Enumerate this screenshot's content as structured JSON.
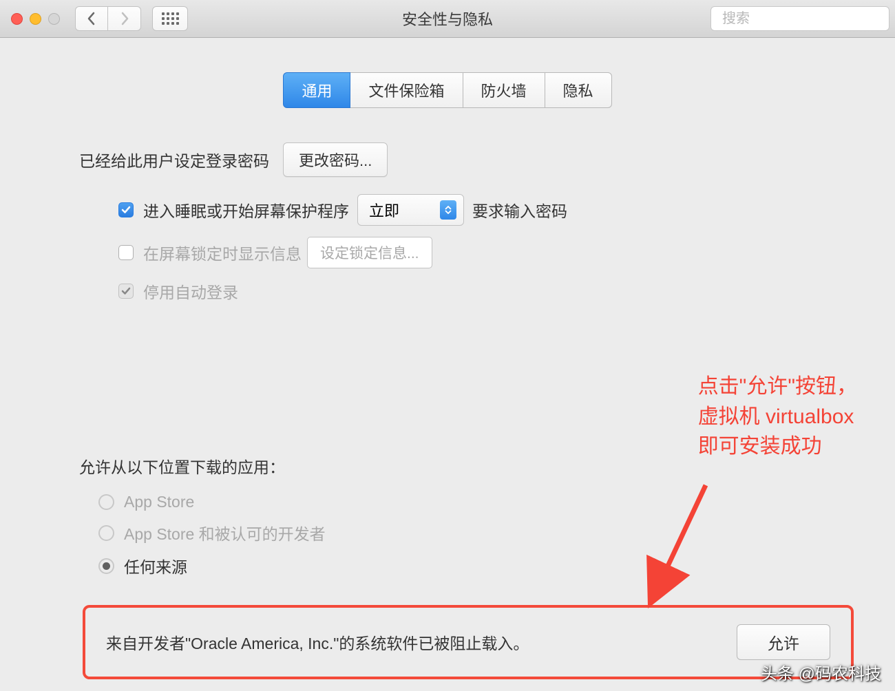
{
  "window": {
    "title": "安全性与隐私"
  },
  "search": {
    "placeholder": "搜索"
  },
  "tabs": [
    {
      "label": "通用",
      "active": true
    },
    {
      "label": "文件保险箱",
      "active": false
    },
    {
      "label": "防火墙",
      "active": false
    },
    {
      "label": "隐私",
      "active": false
    }
  ],
  "password_section": {
    "set_label": "已经给此用户设定登录密码",
    "change_button": "更改密码...",
    "require_password_prefix": "进入睡眠或开始屏幕保护程序",
    "require_password_delay": "立即",
    "require_password_suffix": "要求输入密码",
    "show_message_label": "在屏幕锁定时显示信息",
    "set_lock_message_button": "设定锁定信息...",
    "disable_auto_login_label": "停用自动登录"
  },
  "downloads_section": {
    "title": "允许从以下位置下载的应用：",
    "options": [
      {
        "label": "App Store",
        "selected": false
      },
      {
        "label": "App Store 和被认可的开发者",
        "selected": false
      },
      {
        "label": "任何来源",
        "selected": true
      }
    ]
  },
  "blocked": {
    "message": "来自开发者\"Oracle America, Inc.\"的系统软件已被阻止载入。",
    "allow_button": "允许"
  },
  "annotation": {
    "line1": "点击\"允许\"按钮，",
    "line2": "虚拟机 virtualbox",
    "line3": "即可安装成功"
  },
  "watermark": "头条 @码农科技"
}
